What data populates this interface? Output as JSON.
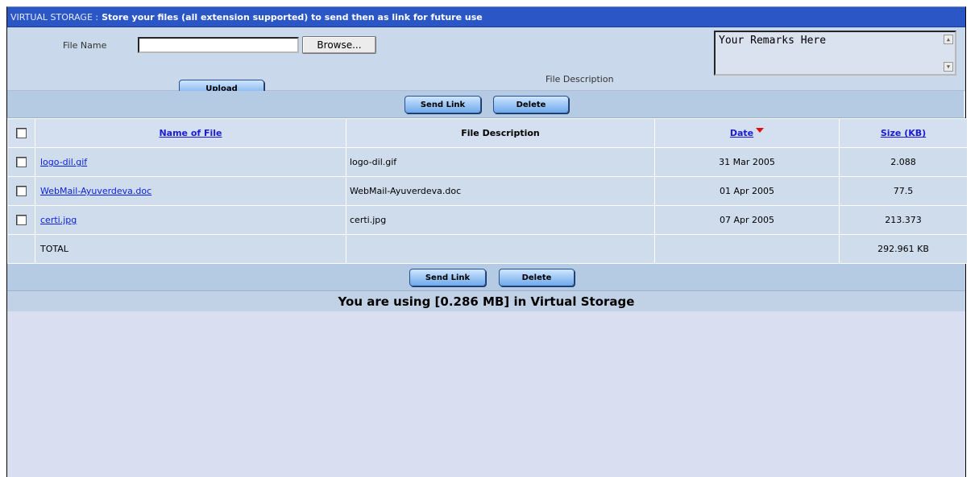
{
  "title": {
    "prefix": "VIRTUAL STORAGE :",
    "text": "Store your files (all extension supported) to send then as link for future use"
  },
  "upload": {
    "file_name_label": "File Name",
    "file_name_value": "",
    "browse_label": "Browse...",
    "upload_label": "Upload",
    "file_description_label": "File Description",
    "remarks_value": "Your Remarks Here"
  },
  "actions": {
    "send_link_label": "Send Link",
    "delete_label": "Delete"
  },
  "table": {
    "headers": {
      "name": "Name of File",
      "description": "File Description",
      "date": "Date",
      "size": "Size (KB)"
    },
    "rows": [
      {
        "name": "logo-dil.gif",
        "description": "logo-dil.gif",
        "date": "31 Mar 2005",
        "size": "2.088"
      },
      {
        "name": "WebMail-Ayuverdeva.doc",
        "description": "WebMail-Ayuverdeva.doc",
        "date": "01 Apr 2005",
        "size": "77.5"
      },
      {
        "name": "certi.jpg",
        "description": "certi.jpg",
        "date": "07 Apr 2005",
        "size": "213.373"
      }
    ],
    "total_label": "TOTAL",
    "total_value": "292.961 KB"
  },
  "usage_text": "You are using [0.286 MB] in Virtual Storage",
  "colors": {
    "title_bar": "#2a56c6",
    "panel": "#c9d8ea",
    "link": "#0a1edc",
    "sort_arrow": "#e01010"
  }
}
